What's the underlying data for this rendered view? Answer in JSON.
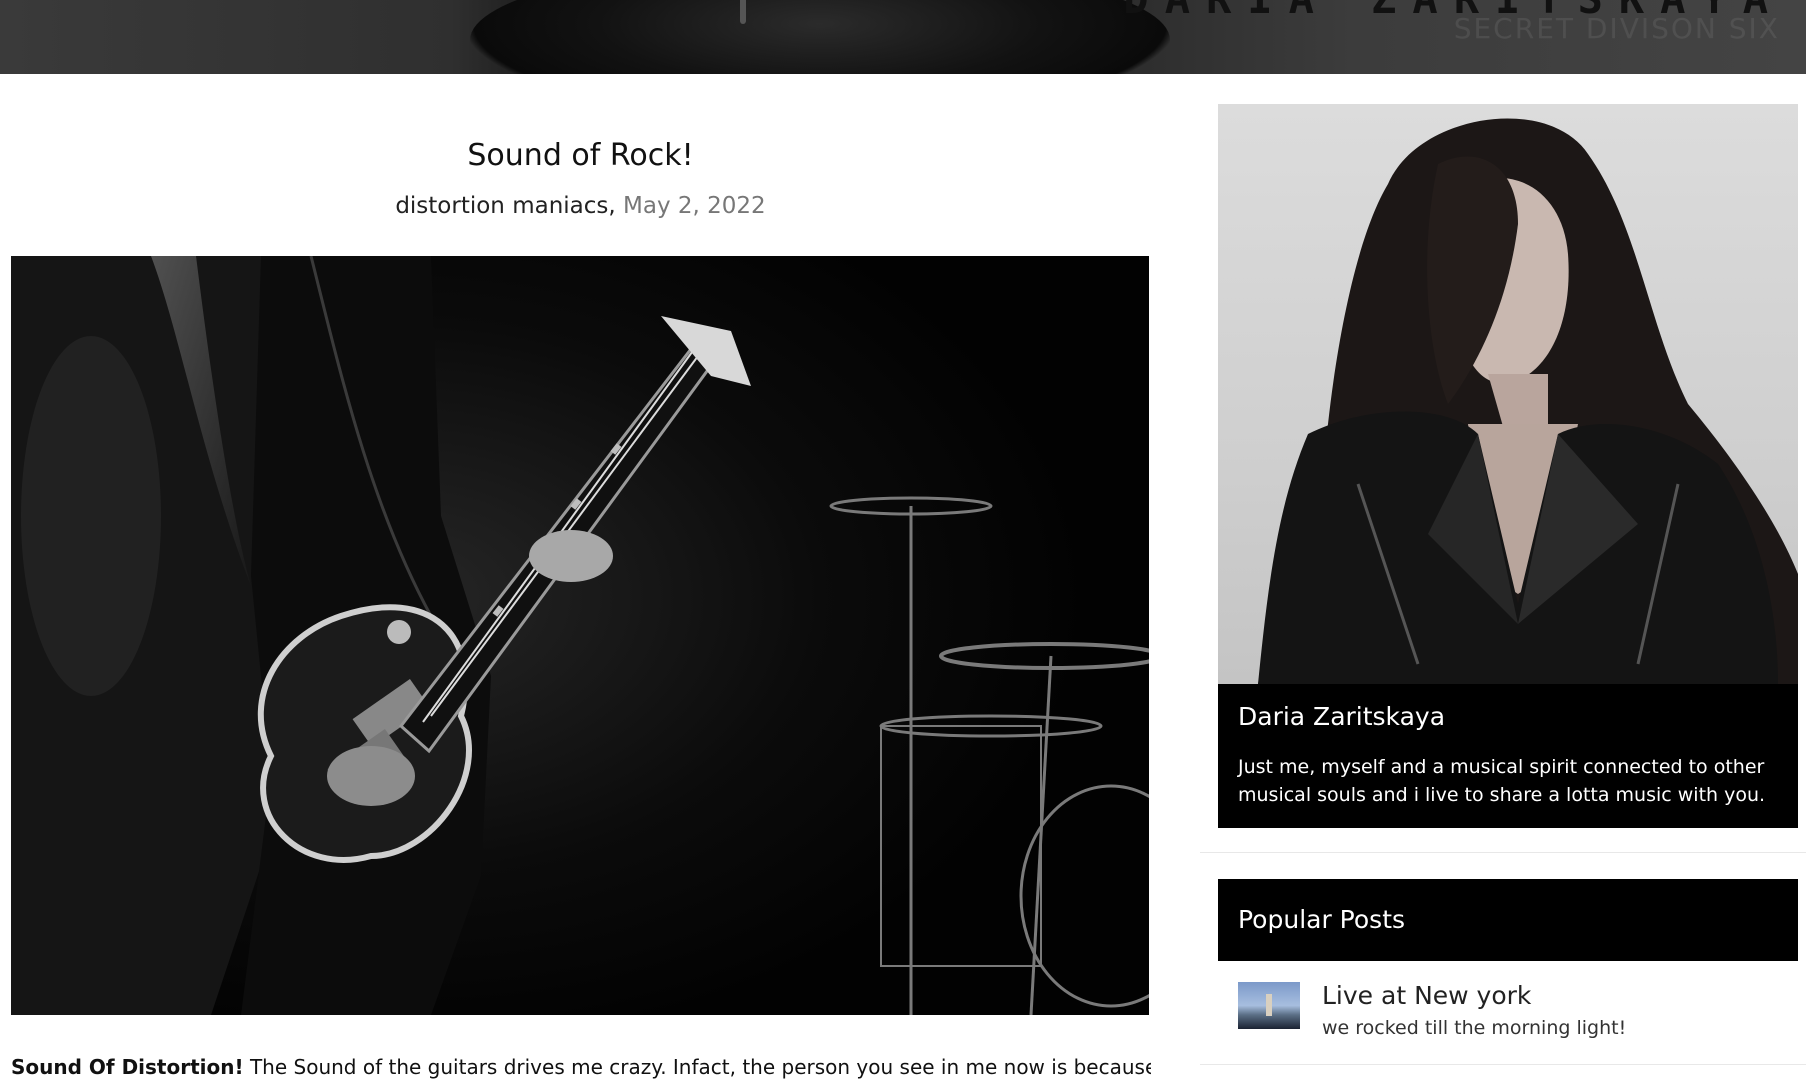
{
  "header": {
    "site_title": "DARIA ZARITSKAYA",
    "site_subtitle": "SECRET DIVISON SIX"
  },
  "post": {
    "title": "Sound of Rock!",
    "author": "distortion maniacs,",
    "date": "May 2, 2022",
    "image_alt": "guitarist-on-stage-photo",
    "excerpt_lead": "Sound Of Distortion!",
    "excerpt_text": " The Sound of the guitars drives me crazy. Infact, the person you see in me now is because of"
  },
  "sidebar": {
    "profile": {
      "name": "Daria Zaritskaya",
      "bio": "Just me, myself and a musical spirit connected to other musical souls and i live to share a lotta music with you."
    },
    "popular_posts": {
      "heading": "Popular Posts",
      "items": [
        {
          "title": "Live at New york",
          "subtitle": "we rocked till the morning light!"
        }
      ]
    }
  },
  "colors": {
    "panel_bg": "#000000",
    "panel_text": "#ffffff",
    "meta_date": "#777777"
  }
}
